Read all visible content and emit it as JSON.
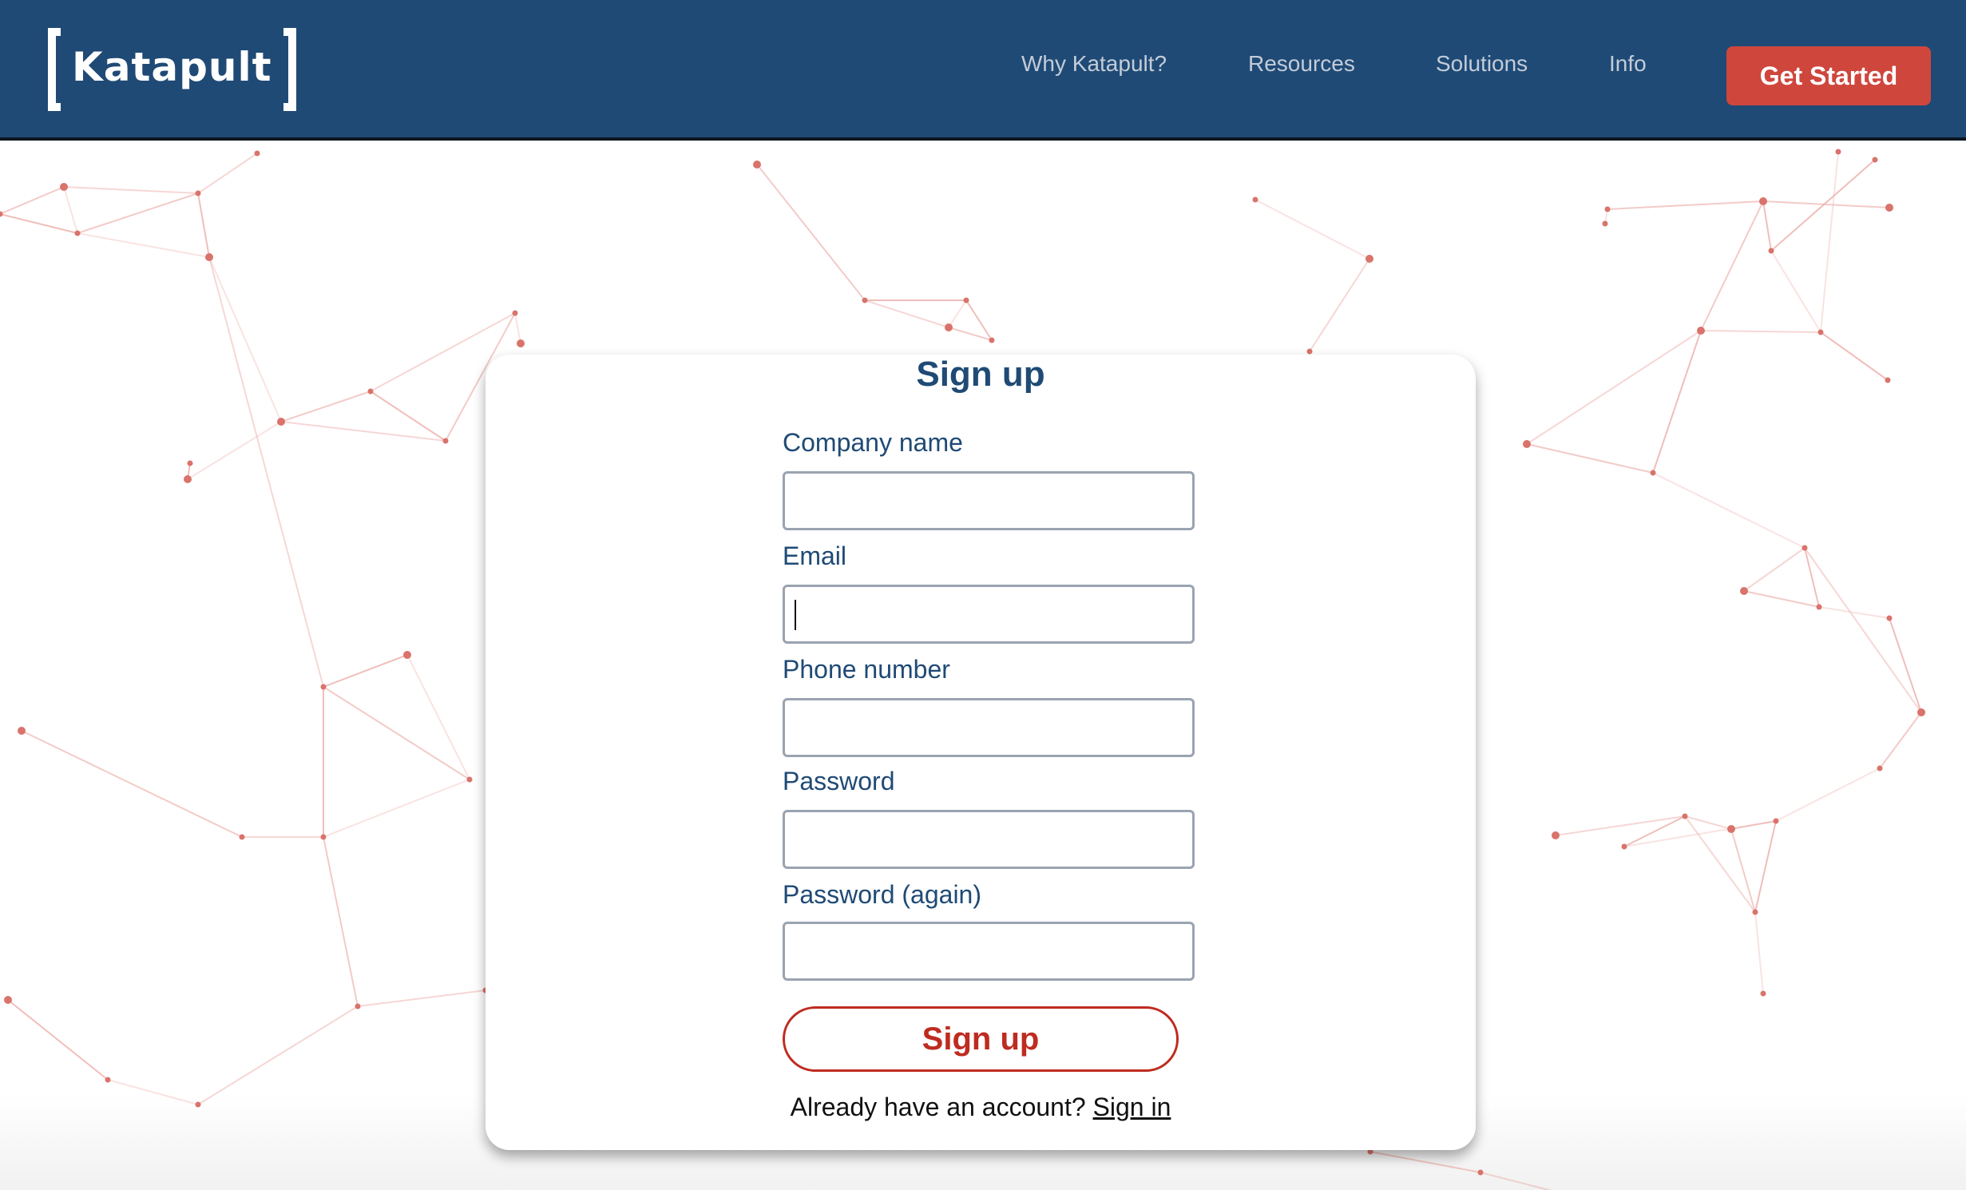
{
  "header": {
    "logo_text": "Katapult",
    "nav": [
      "Why Katapult?",
      "Resources",
      "Solutions",
      "Info"
    ],
    "cta_label": "Get Started"
  },
  "form": {
    "title": "Sign up",
    "fields": [
      {
        "label": "Company name",
        "value": ""
      },
      {
        "label": "Email",
        "value": ""
      },
      {
        "label": "Phone number",
        "value": ""
      },
      {
        "label": "Password",
        "value": ""
      },
      {
        "label": "Password (again)",
        "value": ""
      }
    ],
    "submit_label": "Sign up",
    "footer_text": "Already have an account?",
    "signin_label": "Sign in"
  },
  "colors": {
    "header_bg": "#1f4a75",
    "accent": "#cf463d",
    "label_text": "#1f4a75",
    "network_line": "#e79b95"
  }
}
